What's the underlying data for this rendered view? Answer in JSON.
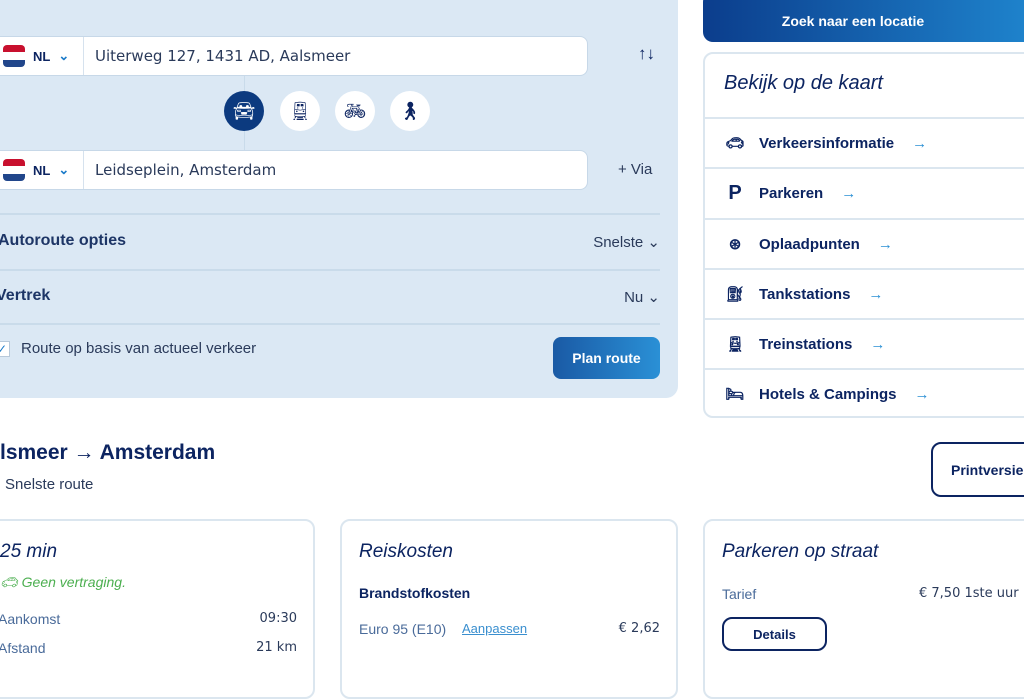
{
  "planner": {
    "origin": {
      "country": "NL",
      "value": "Uiterweg 127, 1431 AD, Aalsmeer"
    },
    "destination": {
      "country": "NL",
      "value": "Leidseplein, Amsterdam"
    },
    "swap_icon": "swap-arrows-icon",
    "via_label": "+ Via",
    "modes": [
      {
        "icon": "car-icon",
        "active": true
      },
      {
        "icon": "train-icon",
        "active": false
      },
      {
        "icon": "bicycle-icon",
        "active": false
      },
      {
        "icon": "walk-icon",
        "active": false
      }
    ],
    "options": [
      {
        "label": "Autoroute opties",
        "value": "Snelste"
      },
      {
        "label": "Vertrek",
        "value": "Nu"
      }
    ],
    "traffic_checkbox": {
      "label": "Route op basis van actueel verkeer",
      "checked": true
    },
    "plan_button": "Plan route"
  },
  "sidebar": {
    "search_button": "Zoek naar een locatie",
    "map_title": "Bekijk op de kaart",
    "items": [
      {
        "label": "Verkeersinformatie",
        "icon": "car-outline-icon"
      },
      {
        "label": "Parkeren",
        "icon": "parking-icon"
      },
      {
        "label": "Oplaadpunten",
        "icon": "charging-plug-icon"
      },
      {
        "label": "Tankstations",
        "icon": "fuel-pump-icon"
      },
      {
        "label": "Treinstations",
        "icon": "train-icon"
      },
      {
        "label": "Hotels & Campings",
        "icon": "bed-icon"
      }
    ]
  },
  "result": {
    "title": "lsmeer → Amsterdam",
    "subtitle": "Snelste route",
    "print_button": "Printversie",
    "time_card": {
      "duration": "25 min",
      "status": "Geen vertraging.",
      "rows": [
        {
          "label": "Aankomst",
          "value": "09:30"
        },
        {
          "label": "Afstand",
          "value": "21 km"
        }
      ]
    },
    "cost_card": {
      "title": "Reiskosten",
      "subtitle": "Brandstofkosten",
      "fuel": "Euro 95 (E10)",
      "adjust_link": "Aanpassen",
      "amount": "€ 2,62"
    },
    "parking_card": {
      "title": "Parkeren op straat",
      "label": "Tarief",
      "value": "€ 7,50 1ste uur",
      "details_button": "Details"
    }
  },
  "colors": {
    "brand": "#0c2461",
    "accent": "#1f86cf",
    "panel": "#dbe8f4",
    "ok": "#4caf50"
  }
}
